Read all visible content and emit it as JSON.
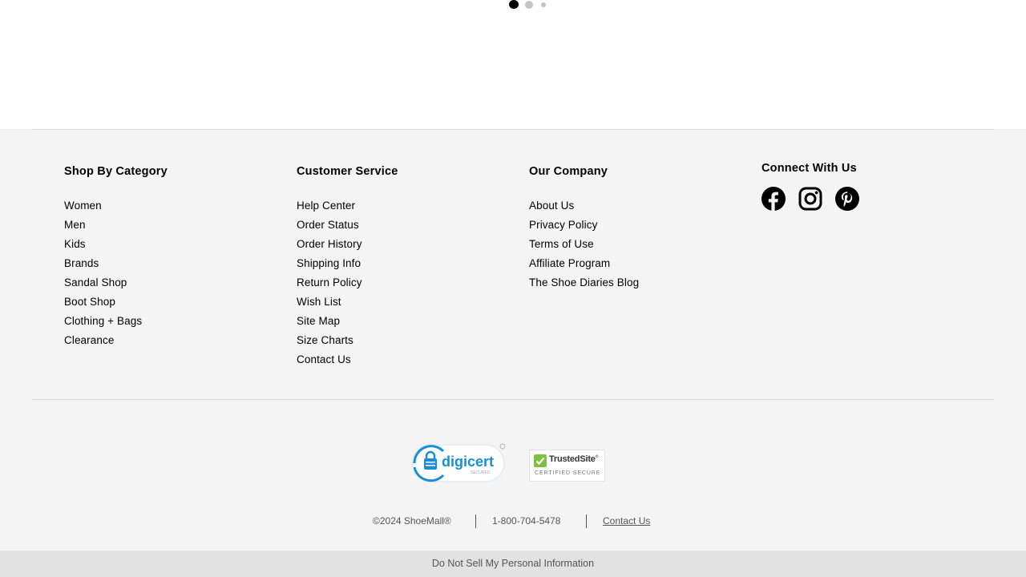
{
  "carousel": {
    "dot_count": 3,
    "active_index": 0
  },
  "columns": {
    "shop": {
      "heading": "Shop By Category",
      "items": [
        "Women",
        "Men",
        "Kids",
        "Brands",
        "Sandal Shop",
        "Boot Shop",
        "Clothing + Bags",
        "Clearance"
      ]
    },
    "service": {
      "heading": "Customer Service",
      "items": [
        "Help Center",
        "Order Status",
        "Order History",
        "Shipping Info",
        "Return Policy",
        "Wish List",
        "Site Map",
        "Size Charts",
        "Contact Us"
      ]
    },
    "company": {
      "heading": "Our Company",
      "items": [
        "About Us",
        "Privacy Policy",
        "Terms of Use",
        "Affiliate Program",
        "The Shoe Diaries Blog"
      ]
    },
    "connect": {
      "heading": "Connect With Us",
      "icons": [
        "facebook-icon",
        "instagram-icon",
        "pinterest-icon"
      ]
    }
  },
  "badges": {
    "digicert": {
      "name": "digicert",
      "sub": "SECURED"
    },
    "trustedsite": {
      "name": "TrustedSite",
      "sub": "CERTIFIED SECURE"
    }
  },
  "legal": {
    "copyright": "©2024 ShoeMall®",
    "phone": "1-800-704-5478",
    "contact": "Contact Us"
  },
  "bottom_bar": {
    "label": "Do Not Sell My Personal Information"
  },
  "colors": {
    "footer_bg": "#f4f4f4",
    "bottom_bar_bg": "#e2e2e2",
    "digicert_blue": "#1a8fd6",
    "trustedsite_green": "#7cc142"
  }
}
